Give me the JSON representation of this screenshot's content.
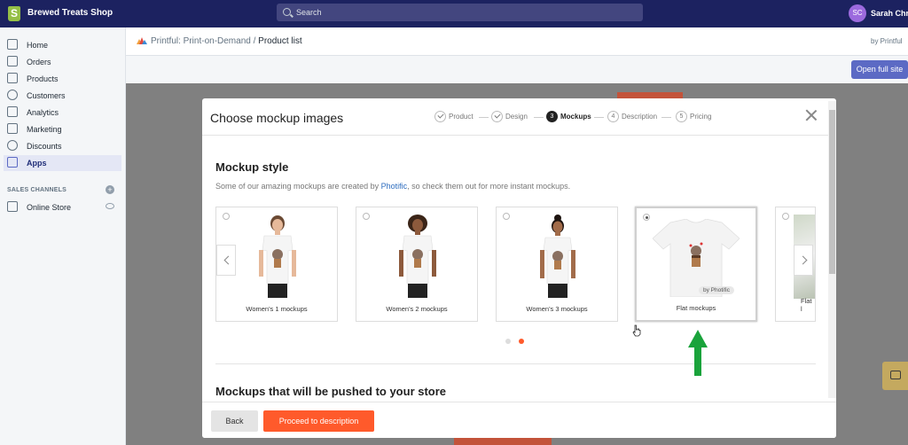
{
  "topbar": {
    "shop_name": "Brewed Treats Shop",
    "search_placeholder": "Search",
    "avatar_initials": "SC",
    "user_name": "Sarah Chris"
  },
  "sidebar": {
    "items": [
      {
        "label": "Home",
        "icon": "home-icon"
      },
      {
        "label": "Orders",
        "icon": "orders-icon"
      },
      {
        "label": "Products",
        "icon": "tag-icon"
      },
      {
        "label": "Customers",
        "icon": "customers-icon"
      },
      {
        "label": "Analytics",
        "icon": "analytics-icon"
      },
      {
        "label": "Marketing",
        "icon": "marketing-icon"
      },
      {
        "label": "Discounts",
        "icon": "discounts-icon"
      },
      {
        "label": "Apps",
        "icon": "apps-icon",
        "active": true
      }
    ],
    "sales_channels_title": "SALES CHANNELS",
    "online_store_label": "Online Store"
  },
  "header": {
    "app_name": "Printful: Print-on-Demand",
    "separator": "/",
    "page": "Product list",
    "by_label": "by Printful",
    "open_full_site": "Open full site"
  },
  "modal": {
    "title": "Choose mockup images",
    "steps": [
      {
        "num": "",
        "label": "Product",
        "state": "done"
      },
      {
        "num": "",
        "label": "Design",
        "state": "done"
      },
      {
        "num": "3",
        "label": "Mockups",
        "state": "active"
      },
      {
        "num": "4",
        "label": "Description",
        "state": "pending"
      },
      {
        "num": "5",
        "label": "Pricing",
        "state": "pending"
      }
    ],
    "mockup_style_heading": "Mockup style",
    "description_prefix": "Some of our amazing mockups are created by ",
    "description_link": "Photific",
    "description_suffix": ", so check them out for more instant mockups.",
    "cards": [
      {
        "caption": "Women's 1 mockups",
        "selected": false
      },
      {
        "caption": "Women's 2 mockups",
        "selected": false
      },
      {
        "caption": "Women's 3 mockups",
        "selected": false
      },
      {
        "caption": "Flat mockups",
        "selected": true,
        "badge": "by Photific"
      },
      {
        "caption": "Flat l",
        "selected": false
      }
    ],
    "pager": {
      "pages": 2,
      "current": 2
    },
    "pushed_heading": "Mockups that will be pushed to your store",
    "back_label": "Back",
    "proceed_label": "Proceed to description"
  },
  "colors": {
    "topbar": "#1c2260",
    "accent": "#5c6ac4",
    "proceed": "#ff5a2b",
    "annotation_arrow": "#1aa33b"
  }
}
